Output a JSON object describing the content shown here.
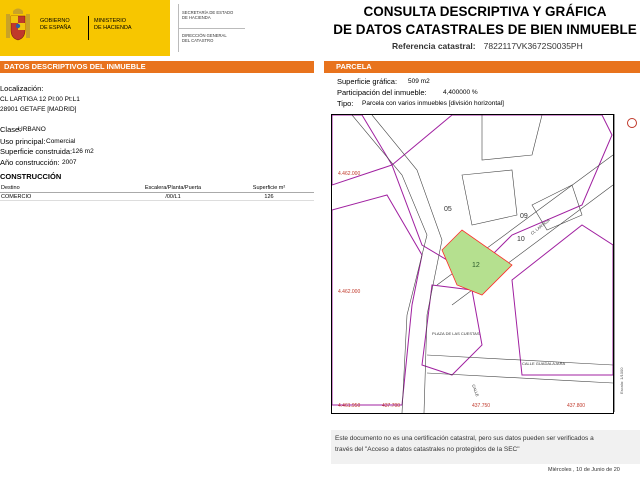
{
  "header": {
    "gov_line1": "GOBIERNO",
    "gov_line2": "DE ESPAÑA",
    "ministry_line1": "MINISTERIO",
    "ministry_line2": "DE HACIENDA",
    "sec_line1": "SECRETARÍA DE ESTADO",
    "sec_line2": "DE HACIENDA",
    "dir_line1": "DIRECCIÓN GENERAL",
    "dir_line2": "DEL CATASTRO",
    "title_line1": "CONSULTA DESCRIPTIVA Y GRÁFICA",
    "title_line2": "DE DATOS CATASTRALES DE BIEN INMUEBLE",
    "ref_label": "Referencia catastral:",
    "ref_value": "7822117VK3672S0035PH"
  },
  "left": {
    "band": "DATOS DESCRIPTIVOS DEL INMUEBLE",
    "loc_label": "Localización:",
    "loc_line1": "CL LARTIGA 12 Pl:00 Pt:L1",
    "loc_line2": "28901 GETAFE [MADRID]",
    "clase_label": "Clase:",
    "clase_value": "URBANO",
    "uso_label": "Uso principal:",
    "uso_value": "Comercial",
    "sup_label": "Superficie construida:",
    "sup_value": "126 m2",
    "anio_label": "Año construcción:",
    "anio_value": "2007",
    "cons_title": "CONSTRUCCIÓN",
    "cons_headers": [
      "Destino",
      "Escalera/Planta/Puerta",
      "Superficie m²"
    ],
    "cons_rows": [
      [
        "COMERCIO",
        "/00/L1",
        "126"
      ]
    ]
  },
  "right": {
    "band": "PARCELA",
    "sup_label": "Superficie gráfica:",
    "sup_value": "509 m2",
    "part_label": "Participación del inmueble:",
    "part_value": "4,400000 %",
    "tipo_label": "Tipo:",
    "tipo_value": "Parcela con varios inmuebles [división horizontal]"
  },
  "map": {
    "parcel_labels": [
      "05",
      "09",
      "10",
      "12"
    ],
    "streets": [
      "CL LARTIGA",
      "CALLE GUADALAJARA",
      "PLAZA DE LAS CUESTAS",
      "CALLE"
    ],
    "coords": [
      "4.462.000",
      "4.462.000",
      "4.461.950",
      "437.700",
      "437.750",
      "437.800"
    ],
    "scale_text": "Escala: 1/1000"
  },
  "note": {
    "line1": "Este documento no es una certificación catastral, pero sus datos pueden ser verificados a",
    "line2": "través del \"Acceso a datos catastrales no protegidos de la SEC\""
  },
  "footer": {
    "date": "Miércoles , 10 de Junio de 20"
  }
}
